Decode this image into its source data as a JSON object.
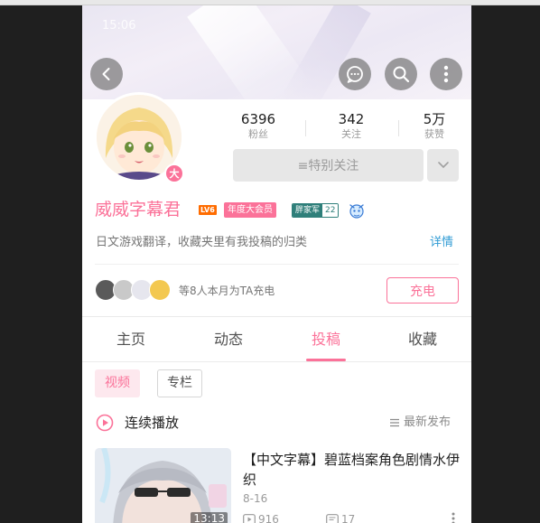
{
  "status_bar": {
    "time": "15:06"
  },
  "header": {
    "back_icon": "chevron-left-icon",
    "message_icon": "chat-bubble-icon",
    "search_icon": "search-icon",
    "more_icon": "vertical-dots-icon"
  },
  "profile": {
    "avatar_badge": "大",
    "stats": [
      {
        "value": "6396",
        "label": "粉丝"
      },
      {
        "value": "342",
        "label": "关注"
      },
      {
        "value": "5万",
        "label": "获赞"
      }
    ],
    "follow_button": "≡特别关注",
    "name": "威威字幕君",
    "level_badge": "LV6",
    "vip_badge": "年度大会员",
    "medal": {
      "name": "胖家军",
      "level": "22"
    },
    "signature": "日文游戏翻译，收藏夹里有我投稿的归类",
    "detail_link": "详情",
    "charge_text": "等8人本月为TA充电",
    "charge_button": "充电"
  },
  "tabs": [
    {
      "label": "主页"
    },
    {
      "label": "动态"
    },
    {
      "label": "投稿",
      "active": true
    },
    {
      "label": "收藏"
    }
  ],
  "subtabs": [
    {
      "label": "视频",
      "active": true
    },
    {
      "label": "专栏"
    }
  ],
  "playlist": {
    "label": "连续播放",
    "sort_label": "最新发布"
  },
  "videos": [
    {
      "title": "【中文字幕】碧蓝档案角色剧情水伊织",
      "duration": "13:13",
      "date": "8-16",
      "plays": "916",
      "danmaku": "17"
    }
  ],
  "colors": {
    "accent": "#fb7299",
    "link": "#2f9bd4",
    "level": "#ff6c00",
    "medal": "#2f7f7a"
  }
}
